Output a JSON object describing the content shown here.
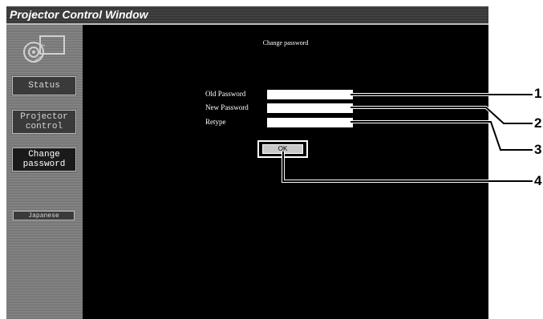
{
  "window": {
    "title": "Projector Control Window"
  },
  "sidebar": {
    "items": [
      {
        "label_line1": "Status",
        "label_line2": ""
      },
      {
        "label_line1": "Projector",
        "label_line2": "control"
      },
      {
        "label_line1": "Change",
        "label_line2": "password"
      }
    ],
    "language_label": "Japanese"
  },
  "form": {
    "heading": "Change password",
    "old_password_label": "Old Password",
    "new_password_label": "New Password",
    "retype_label": "Retype",
    "old_password_value": "",
    "new_password_value": "",
    "retype_value": "",
    "ok_label": "OK"
  },
  "callouts": [
    "1",
    "2",
    "3",
    "4"
  ]
}
